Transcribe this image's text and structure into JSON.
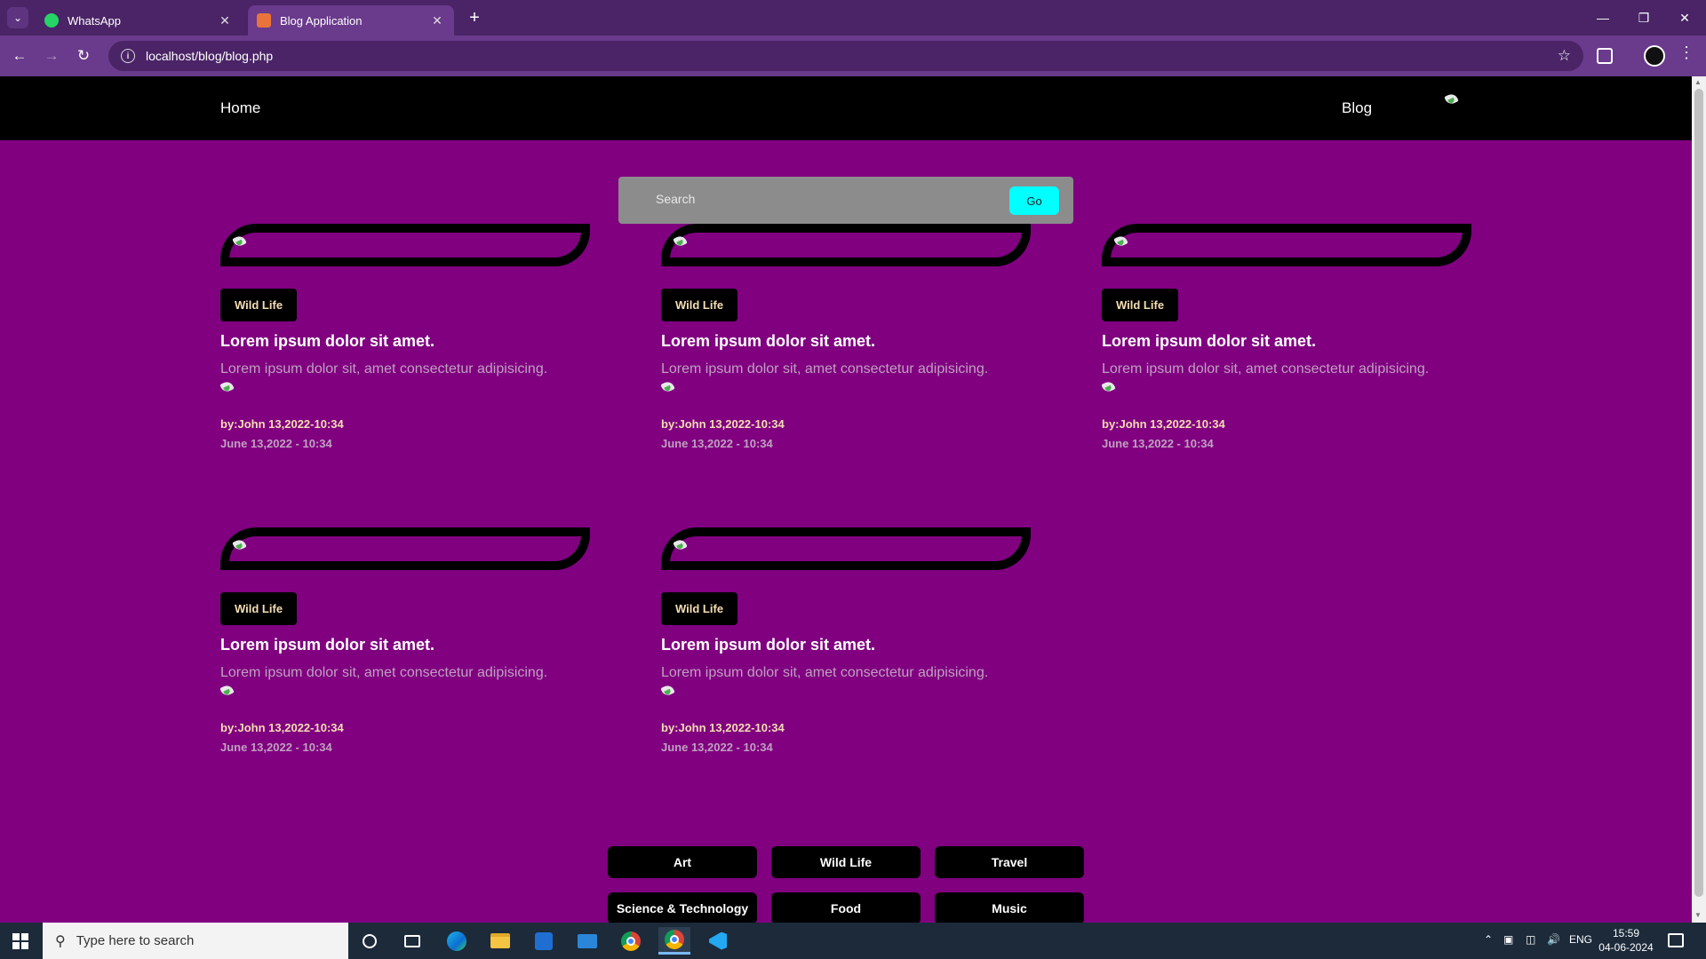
{
  "browser": {
    "tabs": [
      {
        "title": "WhatsApp",
        "icon": "whatsapp-icon"
      },
      {
        "title": "Blog Application",
        "icon": "xampp-icon"
      }
    ],
    "url": "localhost/blog/blog.php"
  },
  "nav": {
    "home": "Home",
    "blog": "Blog"
  },
  "search": {
    "placeholder": "Search",
    "button": "Go"
  },
  "posts": [
    {
      "category": "Wild Life",
      "title": "Lorem ipsum dolor sit amet.",
      "excerpt": "Lorem ipsum dolor sit, amet consectetur adipisicing.",
      "byline": "by:John 13,2022-10:34",
      "date": "June 13,2022 - 10:34"
    },
    {
      "category": "Wild Life",
      "title": "Lorem ipsum dolor sit amet.",
      "excerpt": "Lorem ipsum dolor sit, amet consectetur adipisicing.",
      "byline": "by:John 13,2022-10:34",
      "date": "June 13,2022 - 10:34"
    },
    {
      "category": "Wild Life",
      "title": "Lorem ipsum dolor sit amet.",
      "excerpt": "Lorem ipsum dolor sit, amet consectetur adipisicing.",
      "byline": "by:John 13,2022-10:34",
      "date": "June 13,2022 - 10:34"
    },
    {
      "category": "Wild Life",
      "title": "Lorem ipsum dolor sit amet.",
      "excerpt": "Lorem ipsum dolor sit, amet consectetur adipisicing.",
      "byline": "by:John 13,2022-10:34",
      "date": "June 13,2022 - 10:34"
    },
    {
      "category": "Wild Life",
      "title": "Lorem ipsum dolor sit amet.",
      "excerpt": "Lorem ipsum dolor sit, amet consectetur adipisicing.",
      "byline": "by:John 13,2022-10:34",
      "date": "June 13,2022 - 10:34"
    }
  ],
  "categories": [
    "Art",
    "Wild Life",
    "Travel",
    "Science & Technology",
    "Food",
    "Music"
  ],
  "taskbar": {
    "search_placeholder": "Type here to search",
    "language": "ENG",
    "time": "15:59",
    "date": "04-06-2024"
  },
  "colors": {
    "page_bg": "#800080",
    "nav_bg": "#000000",
    "go_button": "#00ffff",
    "tag_text": "#f5deb3"
  }
}
